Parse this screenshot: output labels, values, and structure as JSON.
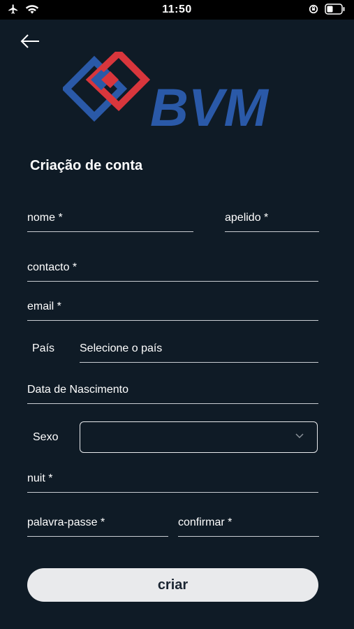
{
  "status_bar": {
    "time": "11:50",
    "left_icons": [
      "airplane-icon",
      "wifi-icon"
    ],
    "right_icons": [
      "orientation-lock-icon",
      "battery-icon"
    ]
  },
  "header": {
    "back_icon": "arrow-left-icon",
    "logo_text": "BVM"
  },
  "form": {
    "title": "Criação de conta",
    "fields": {
      "nome": "nome *",
      "apelido": "apelido *",
      "contacto": "contacto *",
      "email": "email *",
      "pais_label": "País",
      "pais_value": "Selecione o país",
      "data_nascimento": "Data de Nascimento",
      "sexo_label": "Sexo",
      "sexo_value": "",
      "nuit": "nuit *",
      "palavra_passe": "palavra-passe *",
      "confirmar": "confirmar *"
    },
    "submit_label": "criar"
  },
  "colors": {
    "background": "#0f1b26",
    "logo_blue": "#2a59a8",
    "logo_red": "#d8363c",
    "button_bg": "#e9eaec",
    "underline": "#c9cdd2"
  }
}
